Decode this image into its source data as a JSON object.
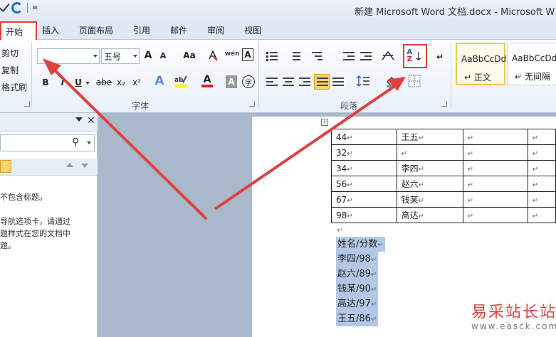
{
  "window": {
    "title": "新建 Microsoft Word 文档.docx - Microsoft W"
  },
  "quick_access": {
    "more": "≡"
  },
  "tabs": [
    {
      "label": "开始",
      "active": true
    },
    {
      "label": "插入"
    },
    {
      "label": "页面布局"
    },
    {
      "label": "引用"
    },
    {
      "label": "邮件"
    },
    {
      "label": "审阅"
    },
    {
      "label": "视图"
    }
  ],
  "clipboard": {
    "cut": "剪切",
    "copy": "复制",
    "format_painter": "格式刷"
  },
  "font": {
    "name_value": "",
    "size_value": "五号",
    "grow": "A",
    "shrink": "A",
    "change_case": "Aa",
    "bold": "B",
    "italic": "I",
    "underline": "U",
    "strike": "abe",
    "subscript": "x₂",
    "superscript": "x²",
    "phonetic": "wén",
    "border_char": "A",
    "shading_char": "A",
    "enclose": "字",
    "group_label": "字体"
  },
  "paragraph": {
    "group_label": "段落"
  },
  "styles": [
    {
      "sample": "AaBbCcDd",
      "name": "↵ 正文",
      "selected": true
    },
    {
      "sample": "AaBbCcDd",
      "name": "↵ 无间隔",
      "selected": false
    }
  ],
  "nav_pane": {
    "lines": [
      "不包含标题。",
      "",
      "导航选项卡，请通过",
      "题样式在您的文档中",
      "题。"
    ]
  },
  "table": {
    "rows": [
      [
        "44",
        "王五",
        "",
        ""
      ],
      [
        "32",
        "",
        "",
        ""
      ],
      [
        "34",
        "李四",
        "",
        ""
      ],
      [
        "56",
        "赵六",
        "",
        ""
      ],
      [
        "67",
        "钱某",
        "",
        ""
      ],
      [
        "98",
        "高达",
        "",
        ""
      ]
    ],
    "cell_mark": "↵"
  },
  "selection": {
    "lines": [
      "姓名/分数",
      "李四/98",
      "赵六/89",
      "钱某/90",
      "高达/97",
      "王五/86"
    ],
    "mark": "↵"
  },
  "watermark": {
    "text": "易采站长站",
    "url": "www.easck.com"
  },
  "colors": {
    "accent_red": "#e0403b",
    "selection": "#b3c8e6",
    "ribbon": "#e9f0f9"
  }
}
